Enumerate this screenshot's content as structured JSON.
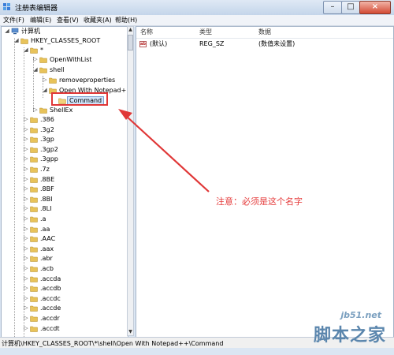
{
  "window": {
    "title": "注册表编辑器"
  },
  "menu": [
    {
      "label": "文件(F)"
    },
    {
      "label": "编辑(E)"
    },
    {
      "label": "查看(V)"
    },
    {
      "label": "收藏夹(A)"
    },
    {
      "label": "帮助(H)"
    }
  ],
  "tree": {
    "root": "计算机",
    "hkcr": "HKEY_CLASSES_ROOT",
    "star": "*",
    "openwithlist": "OpenWithList",
    "shell": "shell",
    "removeproperties": "removeproperties",
    "openwithnotepad": "Open With Notepad++",
    "command": "Command",
    "shellex": "ShellEx",
    "extensions": [
      ".386",
      ".3g2",
      ".3gp",
      ".3gp2",
      ".3gpp",
      ".7z",
      ".8BE",
      ".8BF",
      ".8BI",
      ".8LI",
      ".a",
      ".aa",
      ".AAC",
      ".aax",
      ".abr",
      ".acb",
      ".accda",
      ".accdb",
      ".accdc",
      ".accde",
      ".accdr",
      ".accdt"
    ]
  },
  "columns": {
    "name": "名称",
    "type": "类型",
    "data": "数据"
  },
  "values": [
    {
      "name": "(默认)",
      "type": "REG_SZ",
      "data": "(数值未设置)"
    }
  ],
  "status": {
    "path": "计算机\\HKEY_CLASSES_ROOT\\*\\shell\\Open With Notepad++\\Command"
  },
  "annotation": {
    "text": "注意：必须是这个名字"
  },
  "watermark": {
    "url": "jb51.net",
    "text": "脚本之家"
  },
  "icons": {
    "app": "registry-editor-icon",
    "folder": "folder-icon",
    "value": "string-value-icon"
  },
  "colors": {
    "annotation": "#e53b3b",
    "folder": "#e8c35a",
    "selection": "#cfe3f9"
  }
}
